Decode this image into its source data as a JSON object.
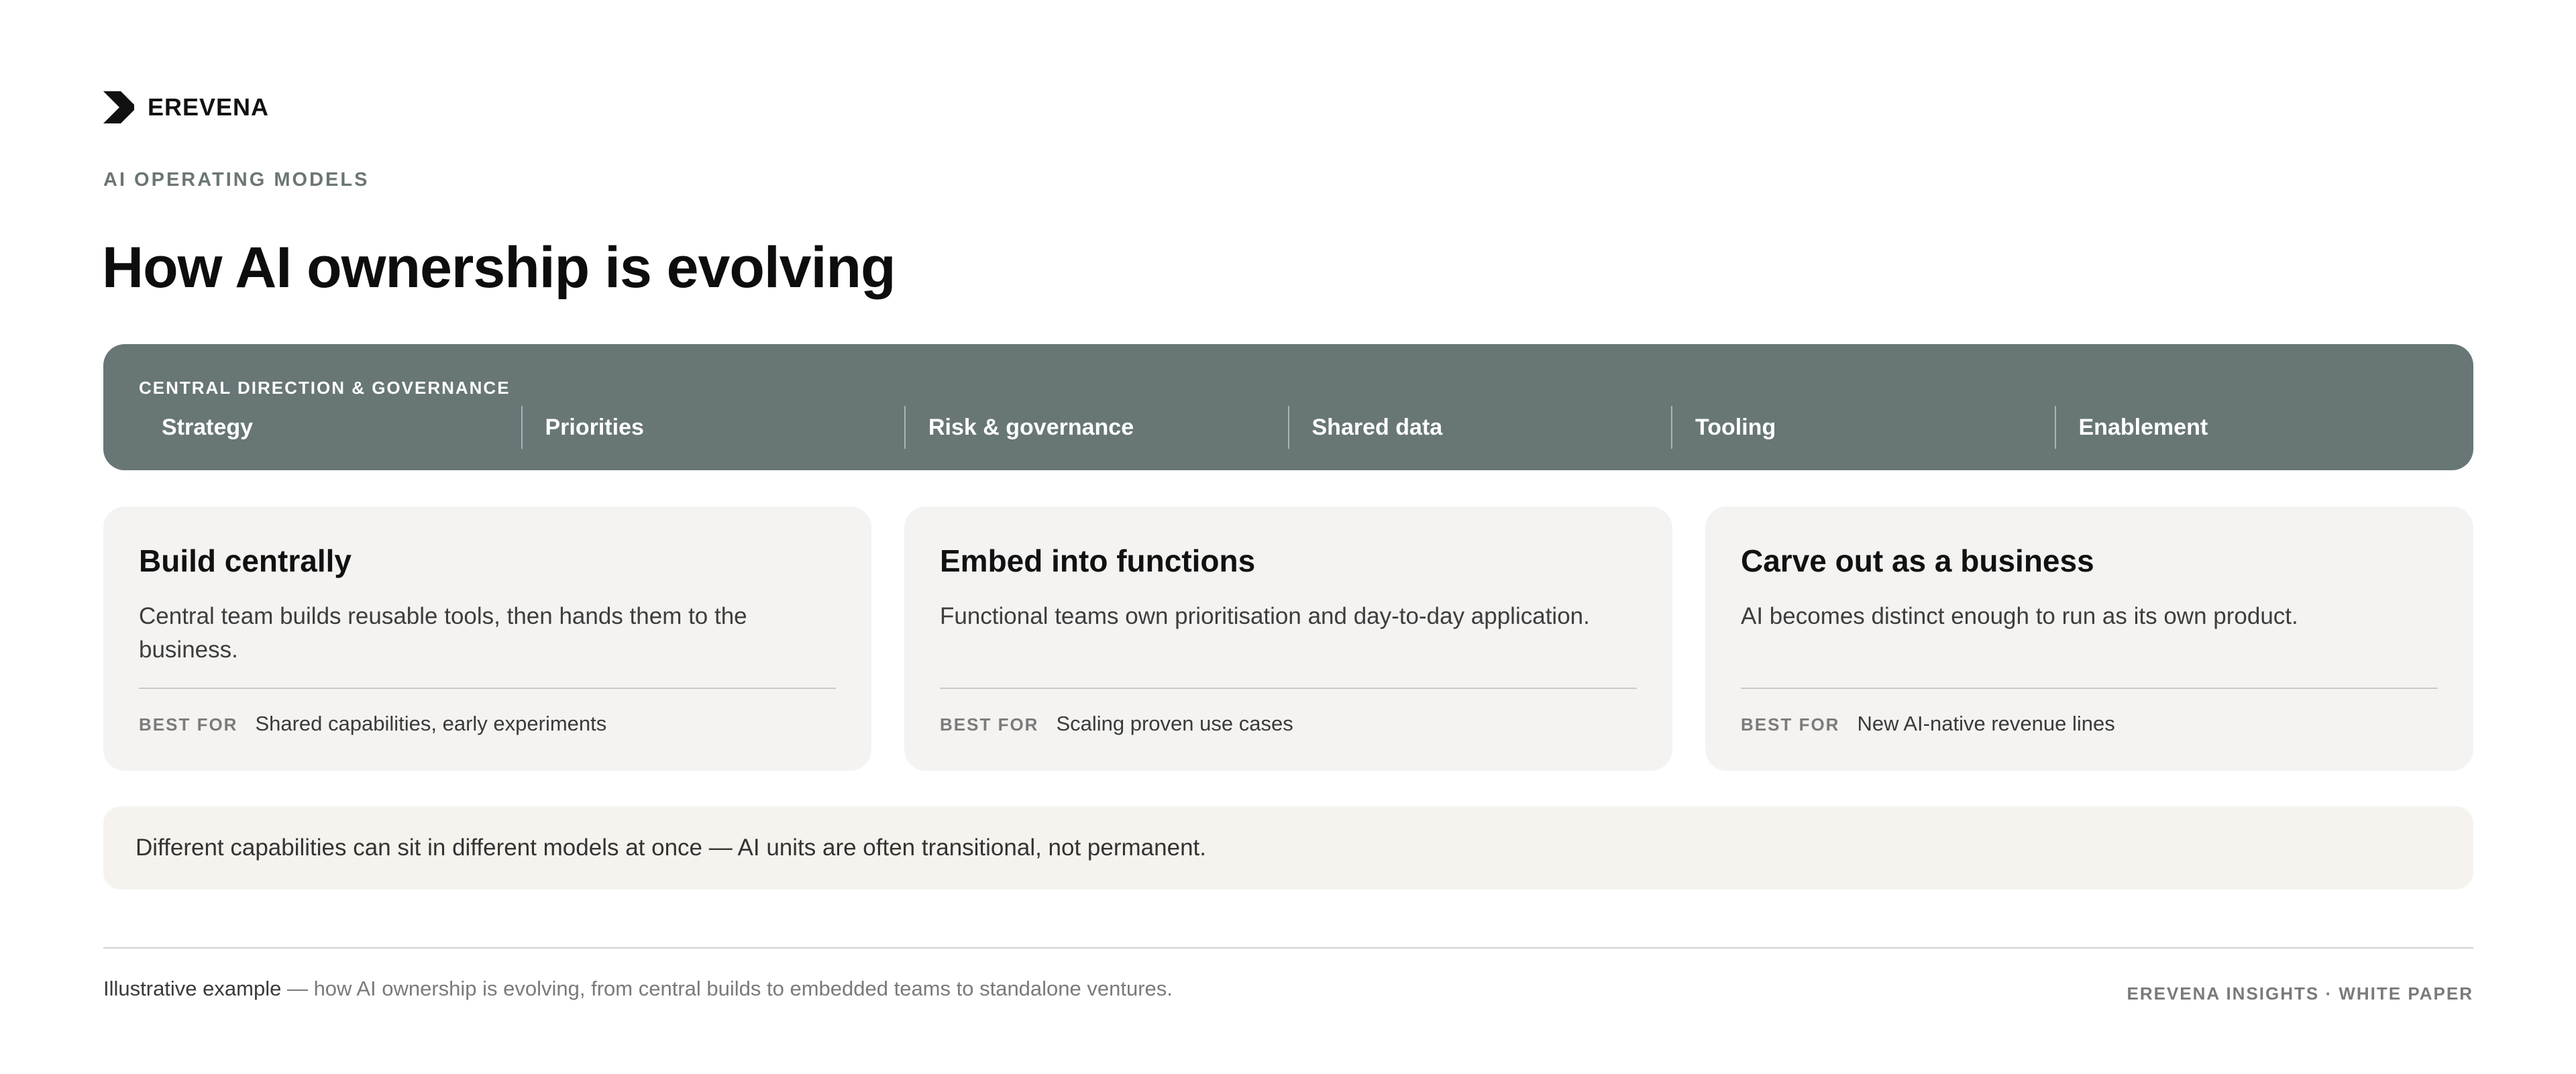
{
  "brand": {
    "name": "EREVENA",
    "icon": "erevena-logo-icon"
  },
  "eyebrow": "AI OPERATING MODELS",
  "title": "How AI ownership is evolving",
  "central": {
    "label": "CENTRAL DIRECTION & GOVERNANCE",
    "items": [
      "Strategy",
      "Priorities",
      "Risk & governance",
      "Shared data",
      "Tooling",
      "Enablement"
    ]
  },
  "cards": [
    {
      "title": "Build centrally",
      "description": "Central team builds reusable tools, then hands them to the business.",
      "best_for_label": "BEST FOR",
      "best_for": "Shared capabilities, early experiments"
    },
    {
      "title": "Embed into functions",
      "description": "Functional teams own prioritisation and day-to-day application.",
      "best_for_label": "BEST FOR",
      "best_for": "Scaling proven use cases"
    },
    {
      "title": "Carve out as a business",
      "description": "AI becomes distinct enough to run as its own product.",
      "best_for_label": "BEST FOR",
      "best_for": "New AI-native revenue lines"
    }
  ],
  "note": "Different capabilities can sit in different models at once — AI units are often transitional, not permanent.",
  "footer": {
    "caption_strong": "Illustrative example",
    "caption_rest": " — how AI ownership is evolving, from central builds to embedded teams to standalone ventures.",
    "source": "EREVENA INSIGHTS · WHITE PAPER"
  },
  "colors": {
    "central_band": "#687676",
    "card_bg": "#f4f3f1",
    "note_bg": "#f6f3ee",
    "muted_text": "#6b7674"
  }
}
